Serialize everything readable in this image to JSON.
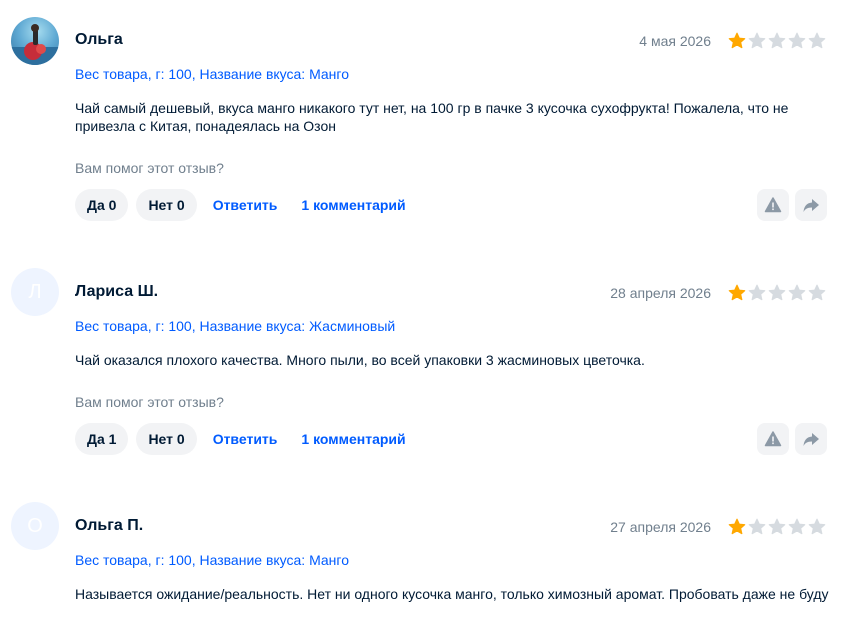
{
  "colors": {
    "accent": "#005bff",
    "star_filled": "#ffa800",
    "star_empty": "#d6dbe0",
    "muted": "#707f8d"
  },
  "reviews": [
    {
      "avatar": {
        "type": "photo",
        "letter": ""
      },
      "name": "Ольга",
      "date": "4 мая 2026",
      "rating": 1,
      "variant": "Вес товара, г: 100, Название вкуса: Манго",
      "text": "Чай самый дешевый, вкуса манго никакого тут нет, на 100 гр в пачке 3 кусочка сухофрукта! Пожалела, что не привезла с Китая, понадеялась на Озон",
      "helpful_prompt": "Вам помог этот отзыв?",
      "yes_label": "Да 0",
      "no_label": "Нет 0",
      "reply_label": "Ответить",
      "comments_label": "1 комментарий"
    },
    {
      "avatar": {
        "type": "letter",
        "letter": "Л"
      },
      "name": "Лариса Ш.",
      "date": "28 апреля 2026",
      "rating": 1,
      "variant": "Вес товара, г: 100, Название вкуса: Жасминовый",
      "text": "Чай оказался плохого качества. Много пыли, во всей упаковки 3 жасминовых цветочка.",
      "helpful_prompt": "Вам помог этот отзыв?",
      "yes_label": "Да 1",
      "no_label": "Нет 0",
      "reply_label": "Ответить",
      "comments_label": "1 комментарий"
    },
    {
      "avatar": {
        "type": "letter",
        "letter": "О"
      },
      "name": "Ольга П.",
      "date": "27 апреля 2026",
      "rating": 1,
      "variant": "Вес товара, г: 100, Название вкуса: Манго",
      "text": "Называется ожидание/реальность. Нет ни одного кусочка манго, только химозный аромат. Пробовать даже не буду",
      "helpful_prompt": "",
      "yes_label": "",
      "no_label": "",
      "reply_label": "",
      "comments_label": ""
    }
  ],
  "icons": {
    "report": "warning-triangle-icon",
    "share": "share-arrow-icon",
    "star": "star-icon"
  }
}
